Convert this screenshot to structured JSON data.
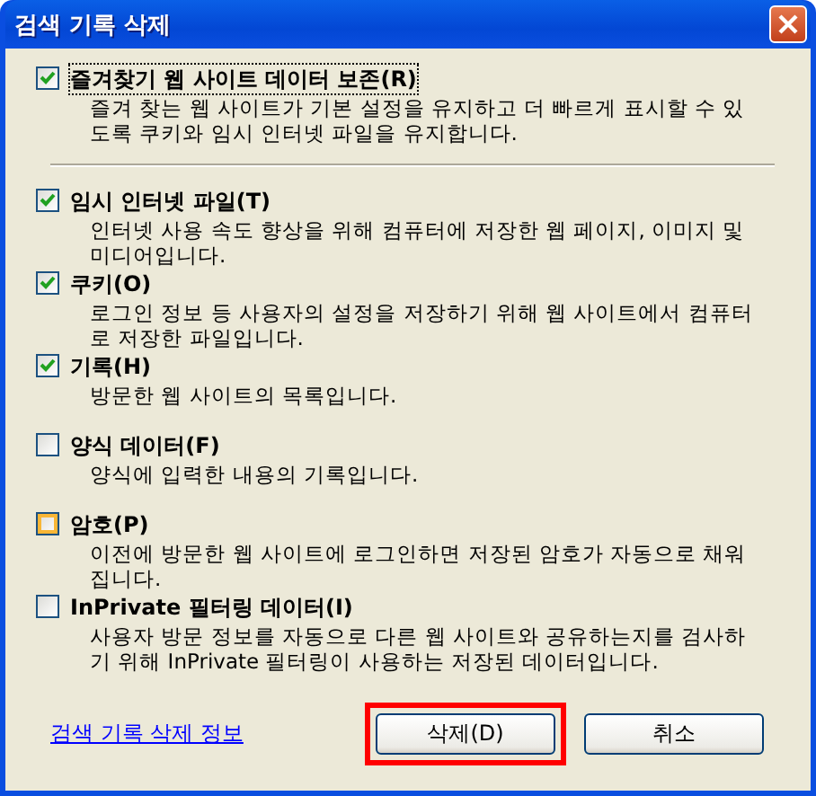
{
  "window": {
    "title": "검색 기록 삭제"
  },
  "options": [
    {
      "label": "즐겨찾기 웹 사이트 데이터 보존(R)",
      "description": "즐겨 찾는 웹 사이트가 기본 설정을 유지하고 더 빠르게 표시할 수 있도록 쿠키와 임시 인터넷 파일을 유지합니다.",
      "checked": true,
      "focused": true,
      "hover": false
    },
    {
      "label": "임시 인터넷 파일(T)",
      "description": "인터넷 사용 속도 향상을 위해 컴퓨터에 저장한 웹 페이지, 이미지 및 미디어입니다.",
      "checked": true,
      "focused": false,
      "hover": false
    },
    {
      "label": "쿠키(O)",
      "description": "로그인 정보 등 사용자의 설정을 저장하기 위해 웹 사이트에서 컴퓨터로 저장한 파일입니다.",
      "checked": true,
      "focused": false,
      "hover": false
    },
    {
      "label": "기록(H)",
      "description": "방문한 웹 사이트의 목록입니다.",
      "checked": true,
      "focused": false,
      "hover": false
    },
    {
      "label": "양식 데이터(F)",
      "description": "양식에 입력한 내용의 기록입니다.",
      "checked": false,
      "focused": false,
      "hover": false
    },
    {
      "label": "암호(P)",
      "description": "이전에 방문한 웹 사이트에 로그인하면 저장된 암호가 자동으로 채워집니다.",
      "checked": false,
      "focused": false,
      "hover": true
    },
    {
      "label": "InPrivate 필터링 데이터(I)",
      "description": "사용자 방문 정보를 자동으로 다른 웹 사이트와 공유하는지를 검사하기 위해 InPrivate 필터링이 사용하는 저장된 데이터입니다.",
      "checked": false,
      "focused": false,
      "hover": false
    }
  ],
  "footer": {
    "link": "검색 기록 삭제 정보",
    "buttons": [
      {
        "label": "삭제(D)",
        "highlighted": true
      },
      {
        "label": "취소",
        "highlighted": false
      }
    ]
  }
}
